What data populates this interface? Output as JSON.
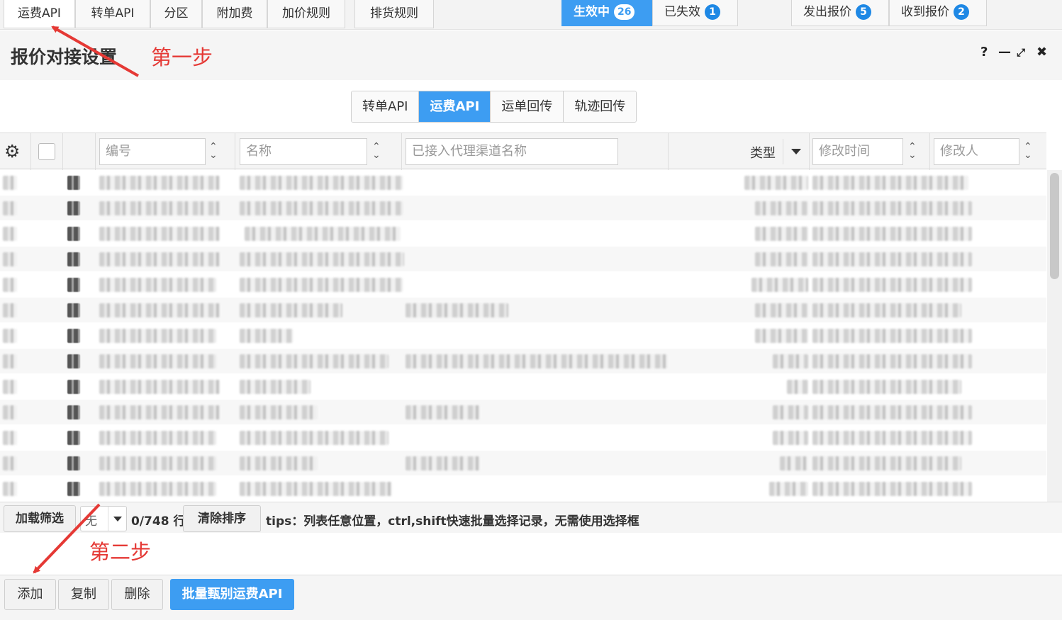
{
  "top_tabs": [
    {
      "label": "运费API"
    },
    {
      "label": "转单API"
    },
    {
      "label": "分区"
    },
    {
      "label": "附加费"
    },
    {
      "label": "加价规则"
    },
    {
      "label": "排货规则"
    }
  ],
  "status_tabs": {
    "active": {
      "label": "生效中",
      "count": "26"
    },
    "expired": {
      "label": "已失效",
      "count": "1"
    },
    "sent": {
      "label": "发出报价",
      "count": "5"
    },
    "received": {
      "label": "收到报价",
      "count": "2"
    }
  },
  "header": {
    "title": "报价对接设置",
    "step1": "第一步",
    "controls": {
      "help": "?",
      "minimize": "—",
      "restore": "⤢",
      "close": "✖"
    }
  },
  "sub_tabs": [
    {
      "label": "转单API",
      "active": false
    },
    {
      "label": "运费API",
      "active": true
    },
    {
      "label": "运单回传",
      "active": false
    },
    {
      "label": "轨迹回传",
      "active": false
    }
  ],
  "grid": {
    "filters": {
      "code_placeholder": "编号",
      "name_placeholder": "名称",
      "channel_placeholder": "已接入代理渠道名称",
      "type_label": "类型",
      "modified_time_placeholder": "修改时间",
      "modifier_placeholder": "修改人"
    },
    "icons": {
      "settings": "gear-icon",
      "sort": "sort-icon",
      "dropdown": "chevron-down-icon"
    }
  },
  "footer": {
    "load_filter": "加载筛选",
    "filter_select_value": "无",
    "row_count": "0/748 行",
    "clear_sort": "清除排序",
    "tips": "tips：列表任意位置，ctrl,shift快速批量选择记录，无需使用选择框"
  },
  "step2": "第二步",
  "actions": {
    "add": "添加",
    "copy": "复制",
    "delete": "删除",
    "batch": "批量甄别运费API"
  },
  "colors": {
    "accent": "#3d9df2",
    "annotation": "#e53935"
  }
}
